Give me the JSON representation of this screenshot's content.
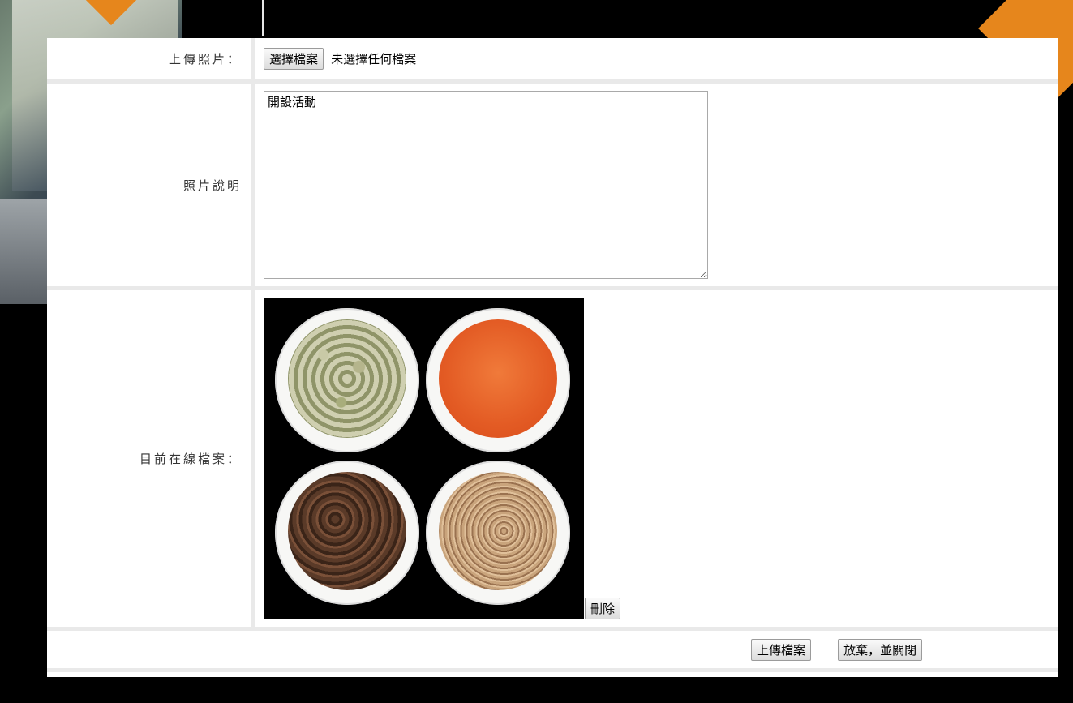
{
  "form": {
    "upload_label": "上傳照片：",
    "choose_file_label": "選擇檔案",
    "file_status": "未選擇任何檔案",
    "description_label": "照片說明",
    "description_value": "開設活動",
    "current_file_label": "目前在線檔案：",
    "delete_label": "刪除",
    "upload_button_label": "上傳檔案",
    "cancel_button_label": "放棄，並關閉"
  },
  "colors": {
    "accent": "#e6861c",
    "row_border": "#e9e9e9",
    "overlay": "#000000"
  }
}
